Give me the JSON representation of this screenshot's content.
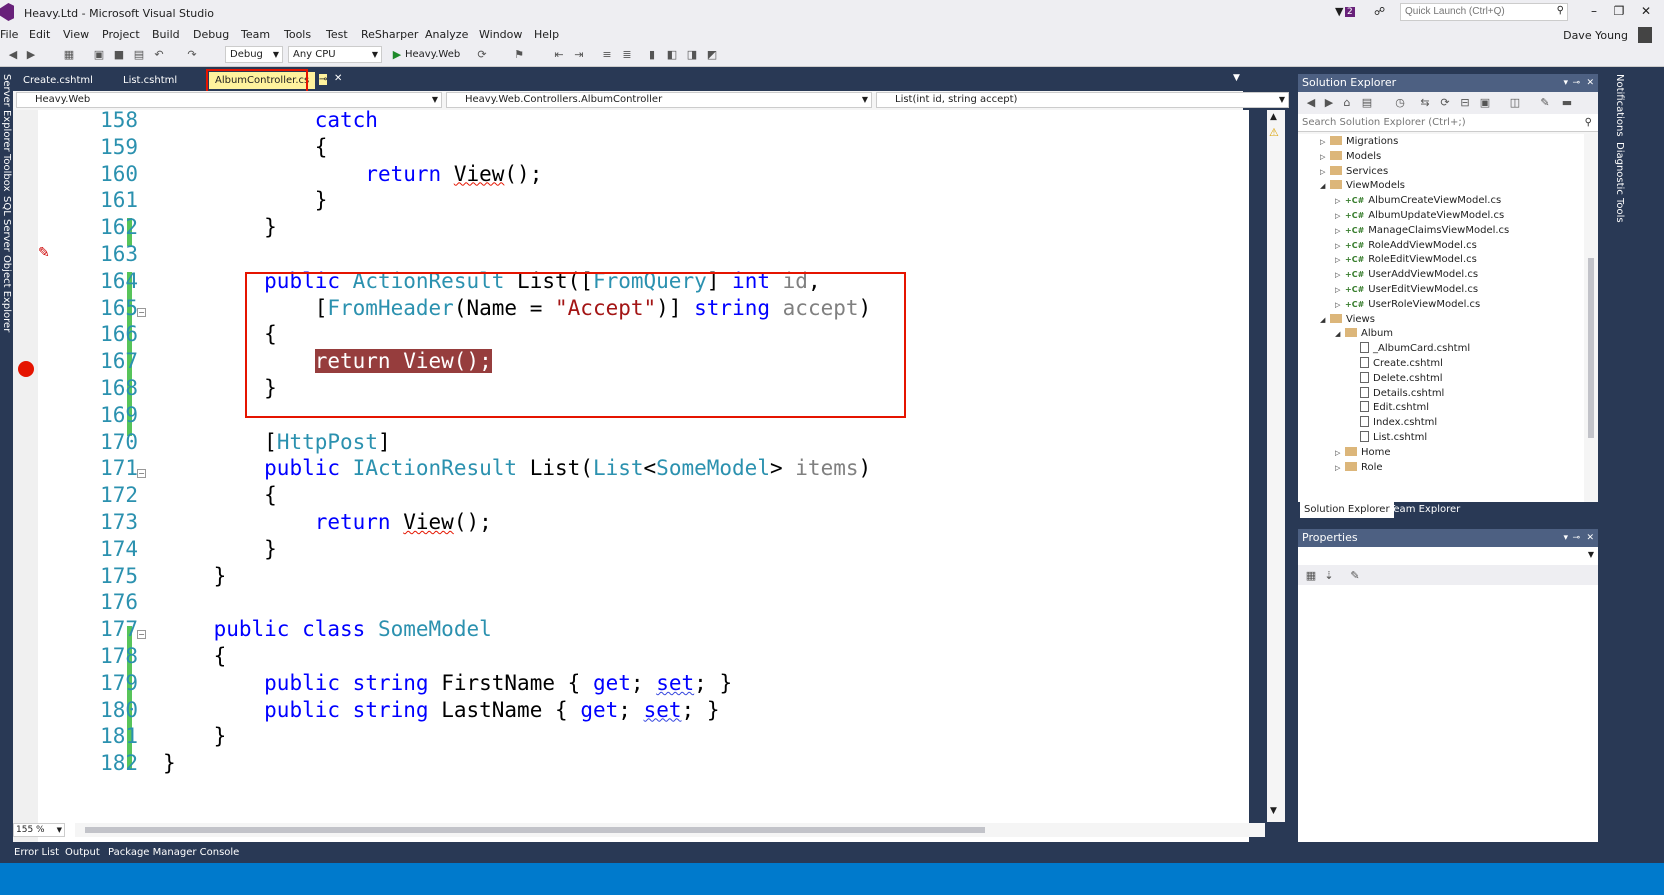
{
  "window": {
    "title": "Heavy.Ltd - Microsoft Visual Studio",
    "quick_launch_placeholder": "Quick Launch (Ctrl+Q)",
    "notification_count": "2",
    "user": "Dave Young"
  },
  "menu": [
    "File",
    "Edit",
    "View",
    "Project",
    "Build",
    "Debug",
    "Team",
    "Tools",
    "Test",
    "ReSharper",
    "Analyze",
    "Window",
    "Help"
  ],
  "toolbar": {
    "config": "Debug",
    "platform": "Any CPU",
    "start_target": "Heavy.Web"
  },
  "tabs": [
    {
      "label": "Create.cshtml",
      "active": false
    },
    {
      "label": "List.cshtml",
      "active": false
    },
    {
      "label": "AlbumController.cs",
      "active": true
    }
  ],
  "navbar": {
    "project": "Heavy.Web",
    "class": "Heavy.Web.Controllers.AlbumController",
    "member": "List(int id, string accept)"
  },
  "editor": {
    "zoom": "155 %",
    "lines": [
      {
        "n": "158",
        "indent": "            ",
        "t": "catch"
      },
      {
        "n": "159",
        "indent": "            ",
        "t": "{"
      },
      {
        "n": "160",
        "indent": "                ",
        "t": "return View();"
      },
      {
        "n": "161",
        "indent": "            ",
        "t": "}"
      },
      {
        "n": "162",
        "indent": "        ",
        "t": "}"
      },
      {
        "n": "163",
        "indent": "",
        "t": ""
      },
      {
        "n": "164",
        "indent": "        ",
        "t": "public ActionResult List([FromQuery] int id,"
      },
      {
        "n": "165",
        "indent": "            ",
        "t": "[FromHeader(Name = \"Accept\")] string accept)"
      },
      {
        "n": "166",
        "indent": "        ",
        "t": "{"
      },
      {
        "n": "167",
        "indent": "            ",
        "t": "return View();"
      },
      {
        "n": "168",
        "indent": "        ",
        "t": "}"
      },
      {
        "n": "169",
        "indent": "",
        "t": ""
      },
      {
        "n": "170",
        "indent": "        ",
        "t": "[HttpPost]"
      },
      {
        "n": "171",
        "indent": "        ",
        "t": "public IActionResult List(List<SomeModel> items)"
      },
      {
        "n": "172",
        "indent": "        ",
        "t": "{"
      },
      {
        "n": "173",
        "indent": "            ",
        "t": "return View();"
      },
      {
        "n": "174",
        "indent": "        ",
        "t": "}"
      },
      {
        "n": "175",
        "indent": "    ",
        "t": "}"
      },
      {
        "n": "176",
        "indent": "",
        "t": ""
      },
      {
        "n": "177",
        "indent": "    ",
        "t": "public class SomeModel"
      },
      {
        "n": "178",
        "indent": "    ",
        "t": "{"
      },
      {
        "n": "179",
        "indent": "        ",
        "t": "public string FirstName { get; set; }"
      },
      {
        "n": "180",
        "indent": "        ",
        "t": "public string LastName { get; set; }"
      },
      {
        "n": "181",
        "indent": "    ",
        "t": "}"
      },
      {
        "n": "182",
        "indent": "",
        "t": "}"
      }
    ]
  },
  "solution_explorer": {
    "title": "Solution Explorer",
    "search_placeholder": "Search Solution Explorer (Ctrl+;)",
    "tree": [
      {
        "label": "Migrations",
        "kind": "folder",
        "level": 0,
        "expanded": false
      },
      {
        "label": "Models",
        "kind": "folder",
        "level": 0,
        "expanded": false
      },
      {
        "label": "Services",
        "kind": "folder",
        "level": 0,
        "expanded": false
      },
      {
        "label": "ViewModels",
        "kind": "folder",
        "level": 0,
        "expanded": true
      },
      {
        "label": "AlbumCreateViewModel.cs",
        "kind": "cs",
        "level": 1
      },
      {
        "label": "AlbumUpdateViewModel.cs",
        "kind": "cs",
        "level": 1
      },
      {
        "label": "ManageClaimsViewModel.cs",
        "kind": "cs",
        "level": 1
      },
      {
        "label": "RoleAddViewModel.cs",
        "kind": "cs",
        "level": 1
      },
      {
        "label": "RoleEditViewModel.cs",
        "kind": "cs",
        "level": 1
      },
      {
        "label": "UserAddViewModel.cs",
        "kind": "cs",
        "level": 1
      },
      {
        "label": "UserEditViewModel.cs",
        "kind": "cs",
        "level": 1
      },
      {
        "label": "UserRoleViewModel.cs",
        "kind": "cs",
        "level": 1
      },
      {
        "label": "Views",
        "kind": "folder",
        "level": 0,
        "expanded": true
      },
      {
        "label": "Album",
        "kind": "folder",
        "level": 1,
        "expanded": true
      },
      {
        "label": "_AlbumCard.cshtml",
        "kind": "cshtml",
        "level": 2
      },
      {
        "label": "Create.cshtml",
        "kind": "cshtml",
        "level": 2
      },
      {
        "label": "Delete.cshtml",
        "kind": "cshtml",
        "level": 2
      },
      {
        "label": "Details.cshtml",
        "kind": "cshtml",
        "level": 2
      },
      {
        "label": "Edit.cshtml",
        "kind": "cshtml",
        "level": 2
      },
      {
        "label": "Index.cshtml",
        "kind": "cshtml",
        "level": 2
      },
      {
        "label": "List.cshtml",
        "kind": "cshtml",
        "level": 2
      },
      {
        "label": "Home",
        "kind": "folder",
        "level": 1,
        "expanded": false
      },
      {
        "label": "Role",
        "kind": "folder",
        "level": 1,
        "expanded": false
      }
    ],
    "tabs": [
      "Solution Explorer",
      "Team Explorer"
    ]
  },
  "properties": {
    "title": "Properties"
  },
  "side_left": [
    "Server Explorer",
    "Toolbox",
    "SQL Server Object Explorer"
  ],
  "side_right": [
    "Notifications",
    "Diagnostic Tools"
  ],
  "bottom_tabs": [
    "Error List",
    "Output",
    "Package Manager Console"
  ],
  "colors": {
    "accent": "#007acc",
    "highlight_box": "#e51400",
    "breakpoint": "#e51400",
    "active_tab": "#fff29d"
  }
}
